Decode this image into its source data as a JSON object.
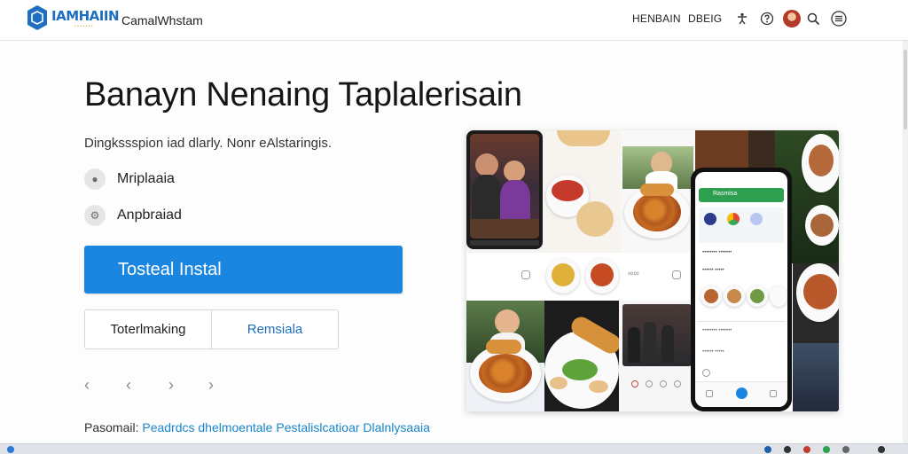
{
  "nav": {
    "logo_text": "IAMHAIIN",
    "logo_sub": "• • • • • • •",
    "brand": "CamalWhstam",
    "links": [
      "HENBAIN",
      "DBEIG"
    ],
    "icons": [
      "accessibility-icon",
      "help-icon",
      "avatar",
      "search-icon",
      "menu-icon"
    ]
  },
  "hero": {
    "headline": "Banayn Nenaing Taplalerisain",
    "subline": "Dingkssspion iad dlarly. Nonr eAlstaringis.",
    "features": [
      "Mriplaaia",
      "Anpbraiad"
    ],
    "primary_cta": "Tosteal Instal",
    "secondary": [
      "Toterlmaking",
      "Remsiala"
    ],
    "carousel_prev": "‹",
    "carousel_next": "›"
  },
  "footer": {
    "label": "Pasomail:",
    "link1": "Peadrdcs dhelmoentale",
    "link2": "Pestalislcatioar Dlalnlysaaia"
  },
  "phone_app": {
    "header": "Rasmisa",
    "rows": [
      "•••••••• •••••••",
      "•••••• •••••"
    ]
  },
  "colors": {
    "accent": "#1a86e0",
    "link": "#1a86c9",
    "app_green": "#2e9e4f"
  }
}
